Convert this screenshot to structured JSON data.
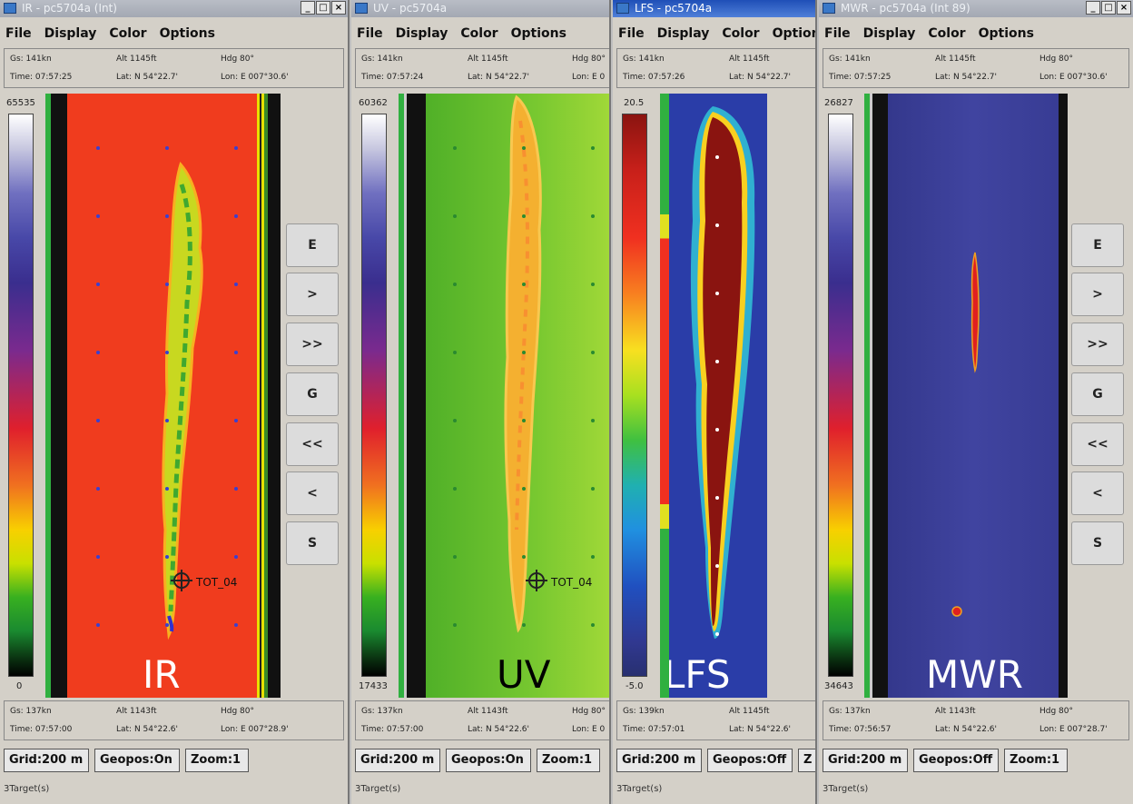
{
  "windows": [
    {
      "id": "ir",
      "title": "IR - pc5704a (Int)",
      "menu": [
        "File",
        "Display",
        "Color",
        "Options"
      ],
      "top_info": {
        "gs": "Gs: 141kn",
        "alt": "Alt 1145ft",
        "hdg": "Hdg 80°",
        "time": "Time: 07:57:25",
        "lat": "Lat: N 54°22.7'",
        "lon": "Lon: E 007°30.6'"
      },
      "bottom_info": {
        "gs": "Gs: 137kn",
        "alt": "Alt 1143ft",
        "hdg": "Hdg 80°",
        "time": "Time: 07:57:00",
        "lat": "Lat: N 54°22.6'",
        "lon": "Lon: E 007°28.9'"
      },
      "scale_max": "65535",
      "scale_min": "0",
      "label": "IR",
      "marker": "TOT_04",
      "status": [
        "Grid:200 m",
        "Geopos:On",
        "Zoom:1"
      ],
      "target": "3Target(s)"
    },
    {
      "id": "uv",
      "title": "UV - pc5704a",
      "menu": [
        "File",
        "Display",
        "Color",
        "Options"
      ],
      "top_info": {
        "gs": "Gs: 141kn",
        "alt": "Alt 1145ft",
        "hdg": "Hdg 80°",
        "time": "Time: 07:57:24",
        "lat": "Lat: N 54°22.7'",
        "lon": "Lon: E 0"
      },
      "bottom_info": {
        "gs": "Gs: 137kn",
        "alt": "Alt 1143ft",
        "hdg": "Hdg 80°",
        "time": "Time: 07:57:00",
        "lat": "Lat: N 54°22.6'",
        "lon": "Lon: E 0"
      },
      "scale_max": "60362",
      "scale_min": "17433",
      "label": "UV",
      "marker": "TOT_04",
      "status": [
        "Grid:200 m",
        "Geopos:On",
        "Zoom:1"
      ],
      "target": "3Target(s)"
    },
    {
      "id": "lfs",
      "title": "LFS - pc5704a",
      "menu": [
        "File",
        "Display",
        "Color",
        "Options"
      ],
      "top_info": {
        "gs": "Gs: 141kn",
        "alt": "Alt 1145ft",
        "time": "Time: 07:57:26",
        "lat": "Lat: N 54°22.7'"
      },
      "bottom_info": {
        "gs": "Gs: 139kn",
        "alt": "Alt 1145ft",
        "time": "Time: 07:57:01",
        "lat": "Lat: N 54°22.6'"
      },
      "scale_max": "20.5",
      "scale_min": "-5.0",
      "label": "LFS",
      "status": [
        "Grid:200 m",
        "Geopos:Off",
        "Z"
      ],
      "target": "3Target(s)"
    },
    {
      "id": "mwr",
      "title": "MWR - pc5704a (Int 89)",
      "menu": [
        "File",
        "Display",
        "Color",
        "Options"
      ],
      "top_info": {
        "gs": "Gs: 141kn",
        "alt": "Alt 1145ft",
        "hdg": "Hdg 80°",
        "time": "Time: 07:57:25",
        "lat": "Lat: N 54°22.7'",
        "lon": "Lon: E 007°30.6'"
      },
      "bottom_info": {
        "gs": "Gs: 137kn",
        "alt": "Alt 1143ft",
        "hdg": "Hdg 80°",
        "time": "Time: 07:56:57",
        "lat": "Lat: N 54°22.6'",
        "lon": "Lon: E 007°28.7'"
      },
      "scale_max": "26827",
      "scale_min": "34643",
      "label": "MWR",
      "status": [
        "Grid:200 m",
        "Geopos:Off",
        "Zoom:1"
      ],
      "target": "3Target(s)"
    }
  ],
  "nav_buttons": [
    "E",
    ">",
    ">>",
    "G",
    "<<",
    "<",
    "S"
  ],
  "window_controls": [
    "_",
    "□",
    "×"
  ],
  "colors": {
    "ir_bg": "#f03c1e",
    "uv_bg": "#58b82a",
    "lfs_bg": "#2a3da8",
    "lfs_slick": "#8a1410",
    "mwr_bg": "#3b3f9a"
  }
}
